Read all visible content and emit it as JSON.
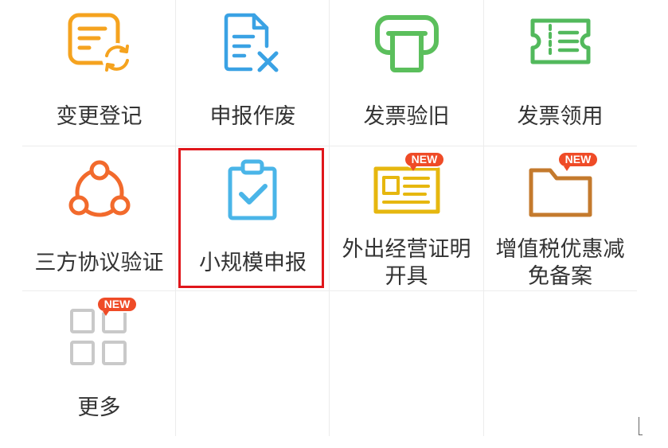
{
  "badge_text": "NEW",
  "colors": {
    "text": "#333333",
    "grid_line": "#ececec",
    "badge": "#ef4b27",
    "highlight": "#e0161b"
  },
  "tiles": [
    {
      "label_lines": [
        "变更登记"
      ],
      "icon": "document-refresh-icon",
      "color": "#f5a31f"
    },
    {
      "label_lines": [
        "申报作废"
      ],
      "icon": "document-cancel-icon",
      "color": "#3aa2e4"
    },
    {
      "label_lines": [
        "发票验旧"
      ],
      "icon": "printer-icon",
      "color": "#5bbf5c"
    },
    {
      "label_lines": [
        "发票领用"
      ],
      "icon": "ticket-icon",
      "color": "#52b95c"
    },
    {
      "label_lines": [
        "三方协议验证"
      ],
      "icon": "share-icon",
      "color": "#f26a2c"
    },
    {
      "label_lines": [
        "小规模申报"
      ],
      "icon": "clipboard-check-icon",
      "color": "#4ab5e8",
      "highlighted": true
    },
    {
      "label_lines": [
        "外出经营证明",
        "开具"
      ],
      "icon": "id-card-icon",
      "color": "#e6b70f",
      "badge": "NEW"
    },
    {
      "label_lines": [
        "增值税优惠减",
        "免备案"
      ],
      "icon": "folder-icon",
      "color": "#c47a2d",
      "badge": "NEW"
    },
    {
      "label_lines": [
        "更多"
      ],
      "icon": "grid-icon",
      "color": "#c9c9c9",
      "badge": "NEW"
    }
  ]
}
